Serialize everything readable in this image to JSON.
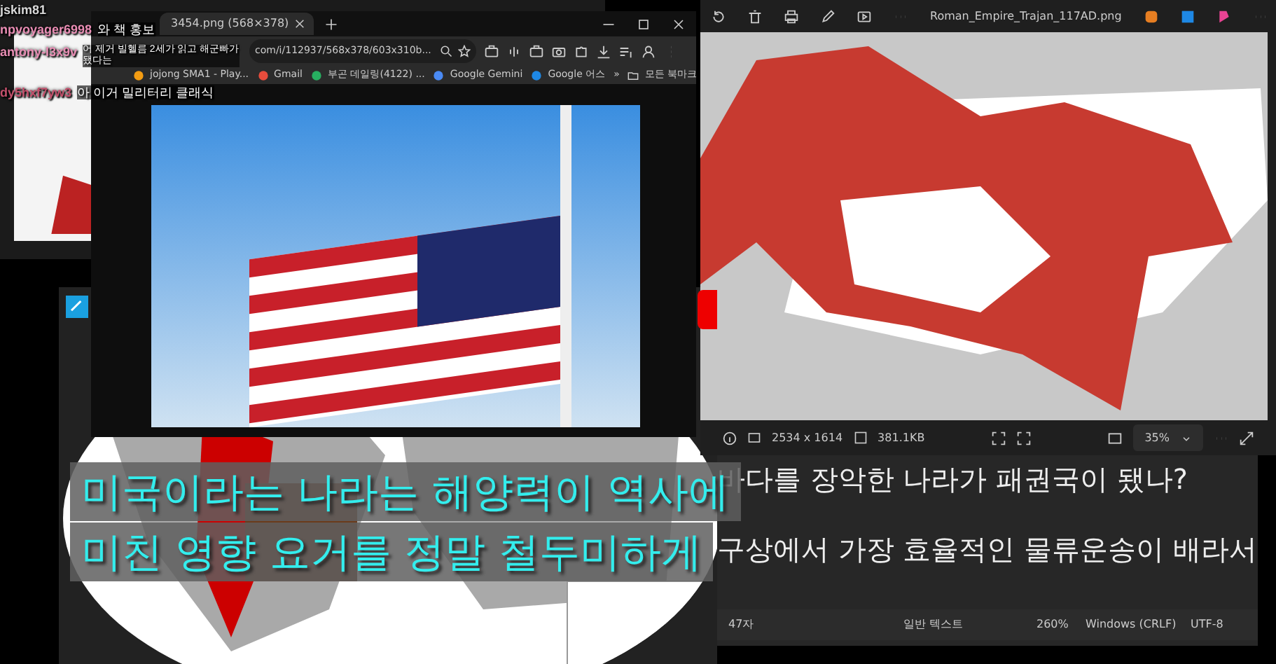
{
  "chat": [
    {
      "user": "jskim81",
      "color": "#d8d8d8"
    },
    {
      "user": "npvoyager6998",
      "color": "#e98db4",
      "message": "와 책 홍보"
    },
    {
      "user": "antony-l3x9v",
      "color": "#e98db4",
      "message": "어 제거 빌헬름 2세가 읽고 해군빠가 됐다는"
    },
    {
      "user": "dy5hxf7yw3",
      "color": "#c4506c",
      "message": "아 이거 밀리터리 클래식"
    }
  ],
  "browser": {
    "tab_title": "3454.png (568×378)",
    "address": "com/i/112937/568x378/603x310b...",
    "bookmarks": [
      "jojong SMA1 - Play...",
      "Gmail",
      "부곤 데일링(4122) ...",
      "Google Gemini",
      "Google 어스"
    ],
    "more": "»",
    "all_bookmarks": "모든 북마크"
  },
  "viewer": {
    "title": "Roman_Empire_Trajan_117AD.png",
    "dimensions": "2534 x 1614",
    "file_size": "381.1KB",
    "zoom": "35%"
  },
  "notepad": {
    "lines": [
      "바다를 장악한 나라가 패권국이 됐나?",
      "구상에서 가장 효율적인 물류운송이 배라서"
    ],
    "status": [
      "47자",
      "일반 텍스트",
      "260%",
      "Windows (CRLF)",
      "UTF-8"
    ]
  },
  "subtitle": {
    "lines": [
      "미국이라는 나라는 해양력이 역사에",
      "미친 영향 요거를 정말 철두미하게"
    ]
  }
}
